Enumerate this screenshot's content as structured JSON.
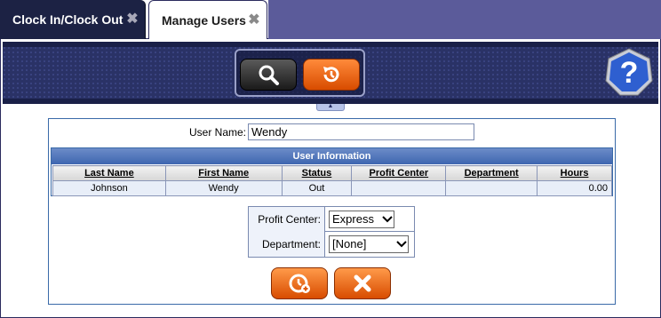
{
  "tabs": [
    {
      "label": "Clock In/Clock Out",
      "active": false
    },
    {
      "label": "Manage Users",
      "active": true
    }
  ],
  "toolbar": {
    "search_icon": "search-icon",
    "reset_icon": "history-reset-icon",
    "help_icon": "help-icon",
    "help_glyph": "?"
  },
  "form": {
    "username_label": "User Name:",
    "username_value": "Wendy"
  },
  "user_info": {
    "title": "User Information",
    "columns": [
      "Last Name",
      "First Name",
      "Status",
      "Profit Center",
      "Department",
      "Hours"
    ],
    "rows": [
      {
        "last_name": "Johnson",
        "first_name": "Wendy",
        "status": "Out",
        "profit_center": "",
        "department": "",
        "hours": "0.00"
      }
    ]
  },
  "settings": {
    "profit_center_label": "Profit Center:",
    "profit_center_value": "Express",
    "department_label": "Department:",
    "department_value": "[None]"
  },
  "actions": {
    "add_icon": "clock-add-icon",
    "cancel_icon": "close-icon"
  },
  "colors": {
    "accent_orange": "#f26a1b",
    "toolbar_navy": "#2a3266",
    "header_blue": "#4a70b8"
  }
}
